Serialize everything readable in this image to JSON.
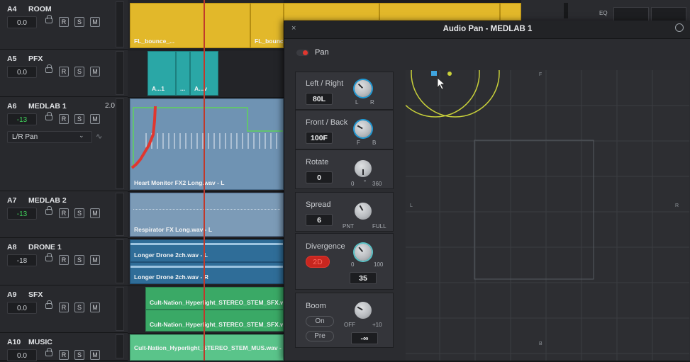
{
  "tracks": [
    {
      "id": "A4",
      "name": "ROOM",
      "volume": "0.0",
      "vol_color": "normal"
    },
    {
      "id": "A5",
      "name": "PFX",
      "volume": "0.0",
      "vol_color": "normal"
    },
    {
      "id": "A6",
      "name": "MEDLAB 1",
      "volume": "-13",
      "vol_color": "green",
      "channels": "2.0",
      "pan_mode": "L/R Pan"
    },
    {
      "id": "A7",
      "name": "MEDLAB 2",
      "volume": "-13",
      "vol_color": "green"
    },
    {
      "id": "A8",
      "name": "DRONE 1",
      "volume": "-18",
      "vol_color": "normal"
    },
    {
      "id": "A9",
      "name": "SFX",
      "volume": "0.0",
      "vol_color": "normal"
    },
    {
      "id": "A10",
      "name": "MUSIC",
      "volume": "0.0",
      "vol_color": "normal"
    }
  ],
  "track_buttons": {
    "record": "R",
    "solo": "S",
    "mute": "M"
  },
  "clips": {
    "room_1": "FL_bounce_...",
    "room_2": "FL_bounce",
    "pfx_1": "A...1",
    "pfx_2": "...",
    "pfx_3": "A...v",
    "medlab1": "Heart Monitor FX2 Long.wav - L",
    "medlab2": "Respirator FX Long.wav - L",
    "drone_l": "Longer Drone 2ch.wav - L",
    "drone_r": "Longer Drone 2ch.wav - R",
    "sfx_1": "Cult-Nation_Hyperlight_STEREO_STEM_SFX.wa",
    "sfx_2": "Cult-Nation_Hyperlight_STEREO_STEM_SFX.wa",
    "music": "Cult-Nation_Hyperlight_STEREO_STEM_MUS.wav - I"
  },
  "mixer": {
    "eq_label": "EQ"
  },
  "panel": {
    "title": "Audio Pan - MEDLAB 1",
    "close": "×",
    "pan_toggle_label": "Pan",
    "left_right": {
      "label": "Left / Right",
      "value": "80L",
      "min": "L",
      "max": "R"
    },
    "front_back": {
      "label": "Front / Back",
      "value": "100F",
      "min": "F",
      "max": "B"
    },
    "rotate": {
      "label": "Rotate",
      "value": "0",
      "min": "0",
      "mid": "°",
      "max": "360"
    },
    "spread": {
      "label": "Spread",
      "value": "6",
      "min": "PNT",
      "max": "FULL"
    },
    "divergence": {
      "label": "Divergence",
      "mode": "2D",
      "min": "0",
      "max": "100",
      "value": "35"
    },
    "boom": {
      "label": "Boom",
      "on_label": "On",
      "pre_label": "Pre",
      "min": "OFF",
      "max": "+10",
      "value": "-∞"
    },
    "grid_labels": {
      "front": "F",
      "back": "B",
      "left": "L",
      "right": "R"
    }
  },
  "colors": {
    "accent_blue": "#1f9ad6",
    "pan_red": "#e0372f",
    "yellow_curve": "#c9d13a"
  }
}
